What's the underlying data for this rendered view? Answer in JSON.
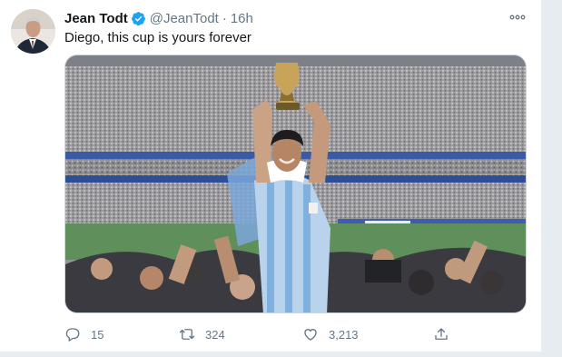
{
  "tweet": {
    "author_name": "Jean Todt",
    "author_handle": "@JeanTodt",
    "separator": "·",
    "time": "16h",
    "text": "Diego, this cup is yours forever",
    "verified": true
  },
  "actions": {
    "replies": "15",
    "retweets": "324",
    "likes": "3,213"
  },
  "colors": {
    "verified_badge": "#1da1f2",
    "secondary_text": "#657786",
    "border": "#e6ecf0"
  },
  "icons": [
    "verified-badge-icon",
    "more-icon",
    "reply-icon",
    "retweet-icon",
    "like-icon",
    "share-icon"
  ],
  "media": {
    "alt_visual": "stadium crowd photo, player in striped shirt raising a trophy"
  }
}
